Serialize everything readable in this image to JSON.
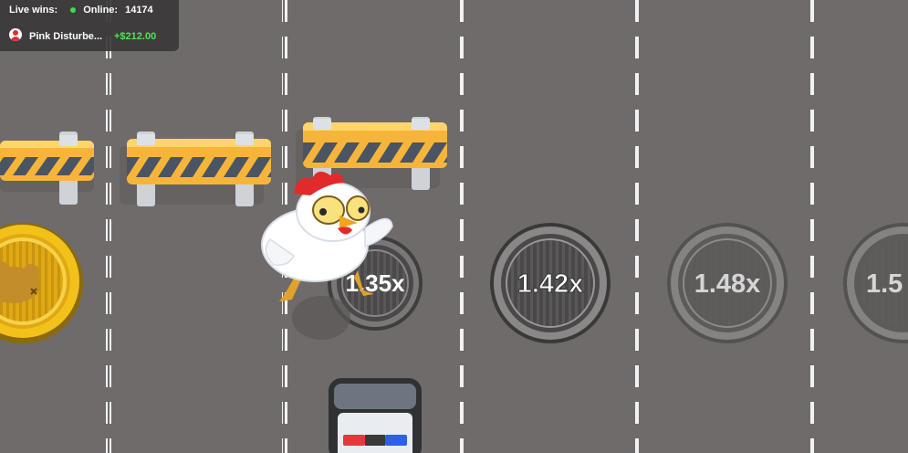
{
  "hud": {
    "live_wins_label": "Live wins:",
    "online_label": "Online:",
    "online_count": "14174",
    "latest_win": {
      "player": "Pink Disturbe...",
      "amount": "+$212.00"
    }
  },
  "board": {
    "lane_multipliers": [
      "1.35x",
      "1.42x",
      "1.48x",
      "1.5"
    ],
    "collected_lane": "coin",
    "current_lane_index": 0,
    "hazard": "police-car"
  },
  "colors": {
    "road": "#6e6b6a",
    "lane_marking": "#f2f2f2",
    "barrier_yellow": "#f6b53a",
    "barrier_stripe": "#4b5462",
    "coin_gold": "#f2c21b",
    "win_green": "#4fe35a",
    "online_dot": "#3ddc52"
  }
}
